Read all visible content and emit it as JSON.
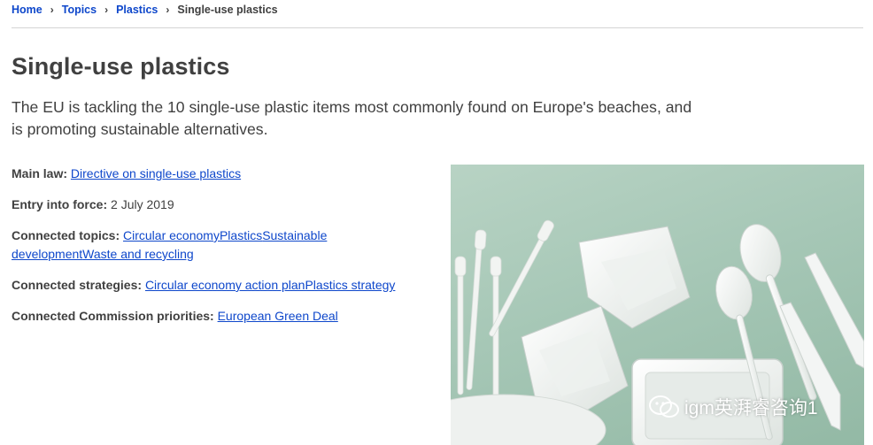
{
  "breadcrumb": {
    "items": [
      {
        "label": "Home"
      },
      {
        "label": "Topics"
      },
      {
        "label": "Plastics"
      }
    ],
    "current": "Single-use plastics"
  },
  "page": {
    "title": "Single-use plastics",
    "intro": "The EU is tackling the 10 single-use plastic items most commonly found on Europe's beaches, and is promoting sustainable alternatives."
  },
  "meta": {
    "main_law": {
      "label": "Main law:",
      "link": "Directive on single-use plastics"
    },
    "entry_into_force": {
      "label": "Entry into force:",
      "value": "2 July 2019"
    },
    "connected_topics": {
      "label": "Connected topics:",
      "links": [
        "Circular economy",
        "Plastics",
        "Sustainable development",
        "Waste and recycling"
      ]
    },
    "connected_strategies": {
      "label": "Connected strategies:",
      "links": [
        "Circular economy action plan",
        "Plastics strategy"
      ]
    },
    "connected_priorities": {
      "label": "Connected Commission priorities:",
      "link": "European Green Deal"
    }
  },
  "image": {
    "icon": "plastic-items-photo",
    "background": "#a6c7b6"
  },
  "watermark": {
    "icon": "wechat-icon",
    "text": "igm英湃睿咨询1"
  },
  "colors": {
    "link": "#0e47cb",
    "text": "#404040",
    "divider": "#d4d4d4"
  }
}
